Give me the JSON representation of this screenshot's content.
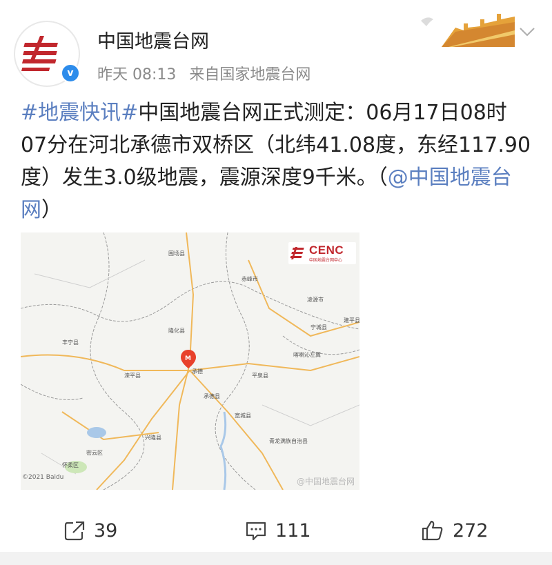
{
  "account": {
    "name": "中国地震台网",
    "verified_icon": "verified-v-badge-icon"
  },
  "meta": {
    "time": "昨天 08:13",
    "source": "来自国家地震台网"
  },
  "post": {
    "hashtag": "#地震快讯#",
    "text": "中国地震台网正式测定：06月17日08时07分在河北承德市双桥区（北纬41.08度，东经117.90度）发生3.0级地震，震源深度9千米。（",
    "mention": "@中国地震台网",
    "close": "）"
  },
  "map_image": {
    "logo_text": "CENC",
    "logo_subtext": "中国地震台网中心",
    "copyright": "©2021 Baidu",
    "watermark": "@中国地震台网",
    "epicenter_marker": "M",
    "place_labels": [
      "围场县",
      "隆化县",
      "承德",
      "丰宁县",
      "滦平县",
      "承德县",
      "宽城县",
      "平泉县",
      "兴隆县",
      "密云区",
      "怀柔区",
      "喀喇沁左翼",
      "宁城县",
      "建平县",
      "青龙满族自治县",
      "凌源市",
      "赤峰市"
    ]
  },
  "actions": {
    "repost_count": "39",
    "comment_count": "111",
    "like_count": "272"
  },
  "colors": {
    "link": "#5b7fc0",
    "text": "#222222",
    "meta": "#8a8a8a",
    "badge": "#2d8ceb",
    "brand_red": "#c1272d"
  }
}
